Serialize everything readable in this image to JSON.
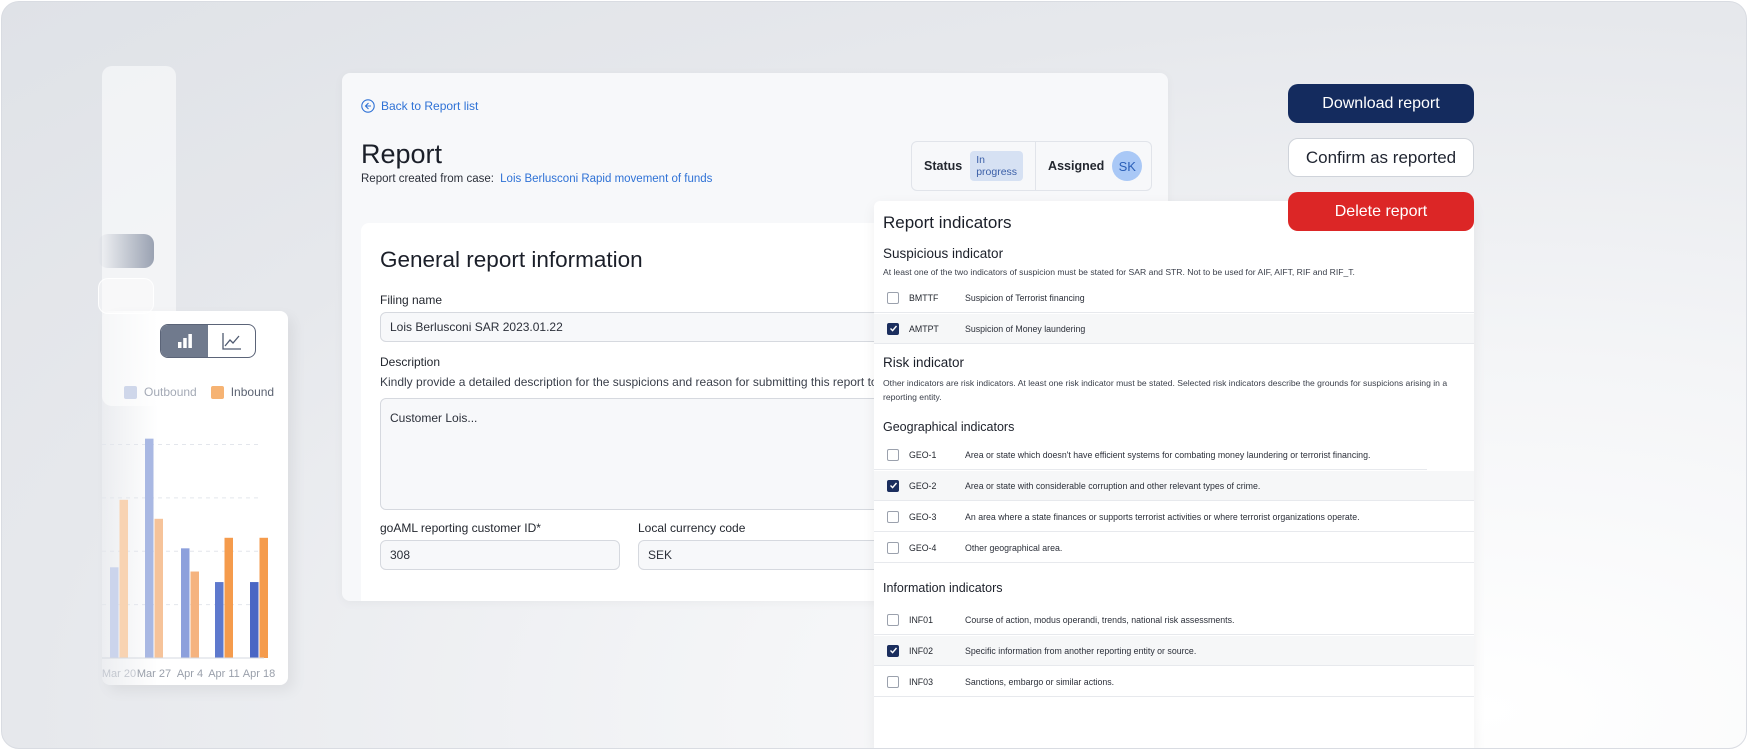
{
  "back_link": "Back to Report list",
  "page": {
    "title": "Report",
    "subtitle_prefix": "Report created from case:",
    "case_link": "Lois Berlusconi Rapid movement of funds"
  },
  "status": {
    "status_label": "Status",
    "status_value": "In progress",
    "assigned_label": "Assigned",
    "assignee_initials": "SK"
  },
  "general": {
    "title": "General report information",
    "filing_name_label": "Filing name",
    "filing_name_value": "Lois Berlusconi SAR 2023.01.22",
    "description_label": "Description",
    "description_help": "Kindly provide a detailed description for the suspicions and reason for submitting this report to F",
    "description_value": "Customer Lois...",
    "customer_id_label": "goAML reporting customer ID*",
    "customer_id_value": "308",
    "currency_label": "Local currency code",
    "currency_value": "SEK"
  },
  "indicators": {
    "title": "Report indicators",
    "suspicious": {
      "title": "Suspicious indicator",
      "note": "At least one of the two indicators of suspicion must be stated for SAR and STR. Not to be used for AIF, AIFT, RIF and RIF_T.",
      "items": [
        {
          "code": "BMTTF",
          "desc": "Suspicion of  Terrorist financing",
          "checked": false
        },
        {
          "code": "AMTPT",
          "desc": "Suspicion of  Money laundering",
          "checked": true
        }
      ]
    },
    "risk": {
      "title": "Risk indicator",
      "note": "Other indicators are risk indicators. At least one risk indicator must be stated. Selected risk indicators describe the grounds for suspicions arising in a reporting entity."
    },
    "geographical": {
      "title": "Geographical indicators",
      "items": [
        {
          "code": "GEO-1",
          "desc": "Area or state which doesn't have efficient systems for combating money laundering or terrorist financing.",
          "checked": false
        },
        {
          "code": "GEO-2",
          "desc": "Area or state with considerable corruption and other relevant types of crime.",
          "checked": true
        },
        {
          "code": "GEO-3",
          "desc": "An area where a state finances or supports terrorist activities or where terrorist organizations operate.",
          "checked": false
        },
        {
          "code": "GEO-4",
          "desc": "Other geographical area.",
          "checked": false
        }
      ]
    },
    "information": {
      "title": "Information indicators",
      "items": [
        {
          "code": "INF01",
          "desc": "Course of action, modus operandi, trends, national risk assessments.",
          "checked": false
        },
        {
          "code": "INF02",
          "desc": "Specific information from another reporting entity or source.",
          "checked": true
        },
        {
          "code": "INF03",
          "desc": "Sanctions, embargo or similar actions.",
          "checked": false
        }
      ]
    }
  },
  "actions": {
    "download": "Download report",
    "confirm": "Confirm as reported",
    "delete": "Delete report"
  },
  "chart_data": {
    "type": "bar",
    "categories": [
      "Mar 20",
      "Mar 27",
      "Apr 4",
      "Apr 11",
      "Apr 18"
    ],
    "series": [
      {
        "name": "Outbound",
        "values": [
          43,
          104,
          52,
          36,
          36
        ]
      },
      {
        "name": "Inbound",
        "values": [
          75,
          66,
          41,
          57,
          57
        ]
      }
    ],
    "ylim": [
      0,
      110
    ],
    "grid": true,
    "legend": "top-left",
    "colors": {
      "Outbound": "#4a66c4",
      "Inbound": "#f59b4c"
    }
  }
}
